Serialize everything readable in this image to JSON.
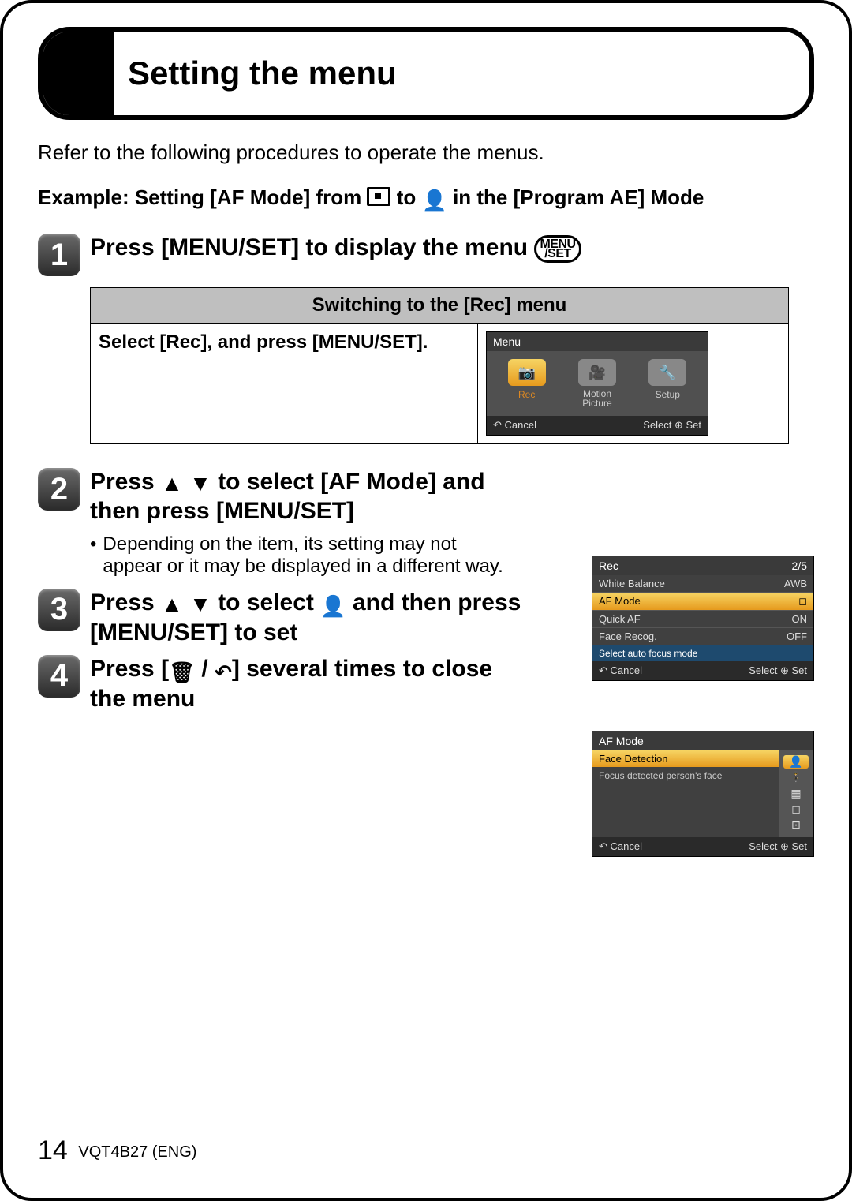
{
  "title": "Setting the menu",
  "intro": "Refer to the following procedures to operate the menus.",
  "example_prefix": "Example: Setting [AF Mode] from ",
  "example_mid": " to ",
  "example_suffix": " in the [Program AE] Mode",
  "step1": {
    "head": "Press [MENU/SET] to display the menu ",
    "badge_top": "MENU",
    "badge_bot": "/SET",
    "switch_header": "Switching to the [Rec] menu",
    "switch_instruction": "Select [Rec], and press [MENU/SET].",
    "screen": {
      "topbar": "Menu",
      "tiles": [
        {
          "icon": "📷",
          "label": "Rec",
          "selected": true
        },
        {
          "icon": "🎥",
          "label": "Motion Picture",
          "selected": false
        },
        {
          "icon": "🔧",
          "label": "Setup",
          "selected": false
        }
      ],
      "cancel": "↶ Cancel",
      "select": "Select ⊕ Set"
    }
  },
  "step2": {
    "head_a": "Press ",
    "head_b": " to select [AF Mode] and then press [MENU/SET]",
    "bullet": "Depending on the item, its setting may not appear or it may be displayed in a different way.",
    "screen": {
      "top_left": "Rec",
      "top_right": "2/5",
      "rows": [
        {
          "label": "White Balance",
          "value": "AWB",
          "sel": false
        },
        {
          "label": "AF Mode",
          "value": "◻",
          "sel": true
        },
        {
          "label": "Quick AF",
          "value": "ON",
          "sel": false
        },
        {
          "label": "Face Recog.",
          "value": "OFF",
          "sel": false
        }
      ],
      "hint": "Select auto focus mode",
      "cancel": "↶ Cancel",
      "select": "Select ⊕ Set"
    }
  },
  "step3": {
    "head_a": "Press ",
    "head_b": " to select ",
    "head_c": " and then press [MENU/SET] to set",
    "screen": {
      "title": "AF Mode",
      "row_sel": "Face Detection",
      "desc": "Focus detected person's face",
      "options": [
        "👤",
        "🕴",
        "▦",
        "◻",
        "⊡"
      ],
      "cancel": "↶ Cancel",
      "select": "Select ⊕ Set"
    }
  },
  "step4": {
    "head_a": "Press [",
    "head_b": " / ",
    "head_c": "] several times to close the menu"
  },
  "footer": {
    "page": "14",
    "code": "VQT4B27 (ENG)"
  }
}
